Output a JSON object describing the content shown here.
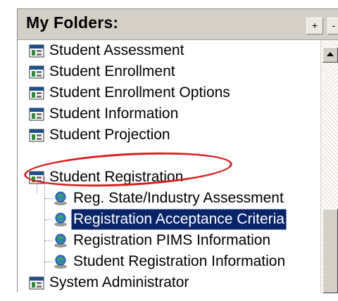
{
  "header": {
    "title": "My Folders:",
    "add_label": "+",
    "remove_label": "-"
  },
  "tree": [
    {
      "label": "Student Assessment",
      "type": "folder",
      "icon": "report-folder-icon"
    },
    {
      "label": "Student Enrollment",
      "type": "folder",
      "icon": "report-folder-icon"
    },
    {
      "label": "Student Enrollment Options",
      "type": "folder",
      "icon": "report-folder-icon"
    },
    {
      "label": "Student Information",
      "type": "folder",
      "icon": "report-folder-icon"
    },
    {
      "label": "Student Projection",
      "type": "folder",
      "icon": "report-folder-icon"
    },
    {
      "label": "Student Registration",
      "type": "folder",
      "icon": "report-folder-icon",
      "expanded": true,
      "highlighted": true
    },
    {
      "label": "Reg. State/Industry Assessment",
      "type": "report",
      "icon": "globe-report-icon"
    },
    {
      "label": "Registration Acceptance Criteria",
      "type": "report",
      "icon": "globe-report-icon",
      "selected": true
    },
    {
      "label": "Registration PIMS Information",
      "type": "report",
      "icon": "globe-report-icon"
    },
    {
      "label": "Student Registration Information",
      "type": "report",
      "icon": "globe-report-icon"
    },
    {
      "label": "System Administrator",
      "type": "folder",
      "icon": "report-folder-icon"
    }
  ],
  "colors": {
    "selection": "#0a246a",
    "highlight_oval": "#d81e1e",
    "header_bg": "#d4d0c8"
  }
}
